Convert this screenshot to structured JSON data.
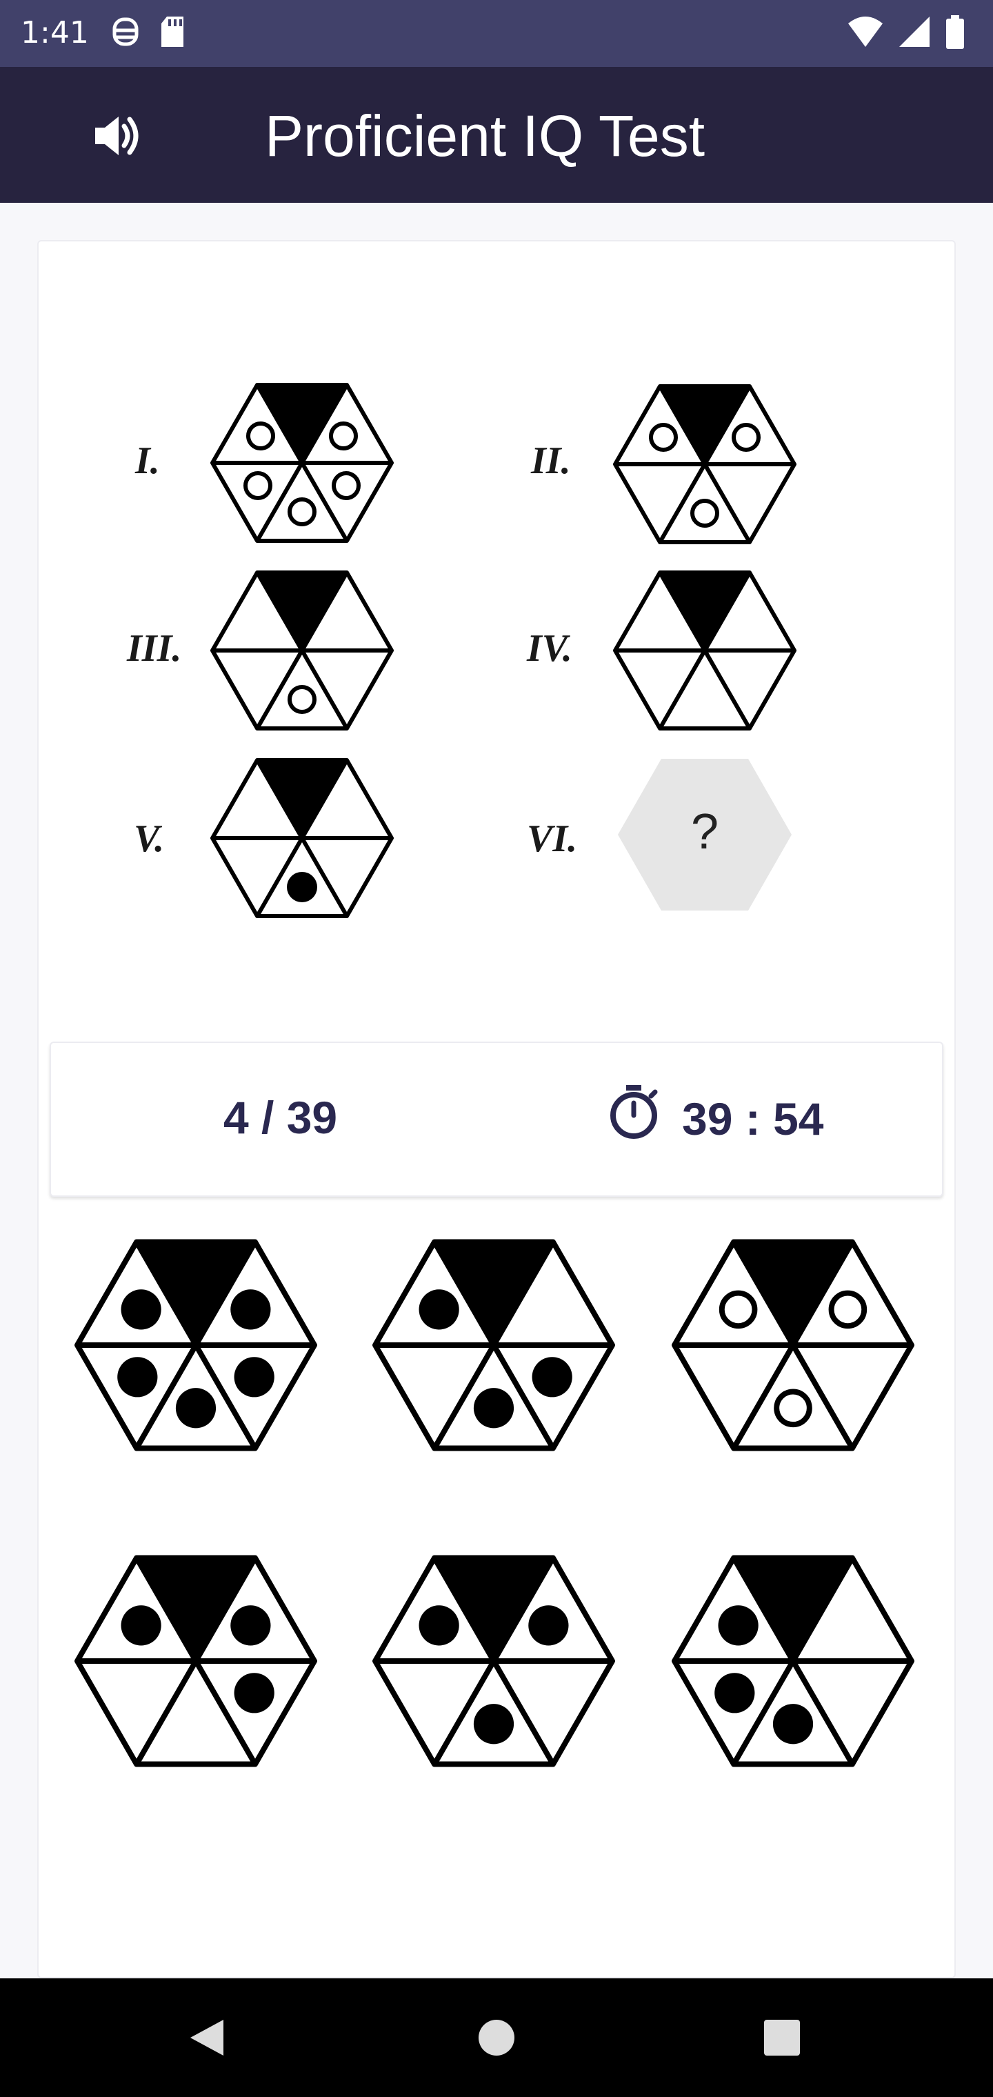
{
  "status_bar": {
    "time": "1:41",
    "left_icons": [
      "usb-debug-icon",
      "sd-card-icon"
    ],
    "right_icons": [
      "wifi-icon",
      "cellular-signal-icon",
      "battery-icon"
    ]
  },
  "app_bar": {
    "title": "Proficient IQ Test",
    "sound_icon": "speaker-icon"
  },
  "question": {
    "items": [
      {
        "label": "I.",
        "kind": "figure"
      },
      {
        "label": "II.",
        "kind": "figure"
      },
      {
        "label": "III.",
        "kind": "figure"
      },
      {
        "label": "IV.",
        "kind": "figure"
      },
      {
        "label": "V.",
        "kind": "figure"
      },
      {
        "label": "VI.",
        "kind": "placeholder",
        "text": "?"
      }
    ]
  },
  "status": {
    "progress": "4 / 39",
    "timer": "39 : 54",
    "timer_icon": "stopwatch-icon"
  },
  "colors": {
    "status_bar": "#41416a",
    "app_bar": "#27233f",
    "text_dark": "#2a2850",
    "placeholder": "#e6e6e6"
  }
}
